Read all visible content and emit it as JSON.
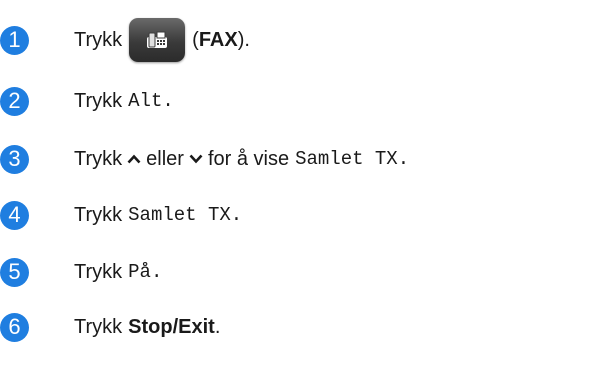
{
  "steps": [
    {
      "number": "1",
      "prefix": "Trykk",
      "paren_open": "(",
      "bold": "FAX",
      "paren_close": ").",
      "icon": "fax-icon"
    },
    {
      "number": "2",
      "prefix": "Trykk",
      "mono": "Alt",
      "suffix": "."
    },
    {
      "number": "3",
      "prefix": "Trykk",
      "middle": "eller",
      "after": "for å vise",
      "mono": "Samlet TX",
      "suffix": ".",
      "icons": [
        "caret-up-icon",
        "caret-down-icon"
      ]
    },
    {
      "number": "4",
      "prefix": "Trykk",
      "mono": "Samlet TX",
      "suffix": "."
    },
    {
      "number": "5",
      "prefix": "Trykk",
      "mono": "På",
      "suffix": "."
    },
    {
      "number": "6",
      "prefix": "Trykk",
      "bold": "Stop/Exit",
      "suffix": "."
    }
  ],
  "colors": {
    "step_badge": "#1f7ee0",
    "button": "#3a3a3a"
  }
}
